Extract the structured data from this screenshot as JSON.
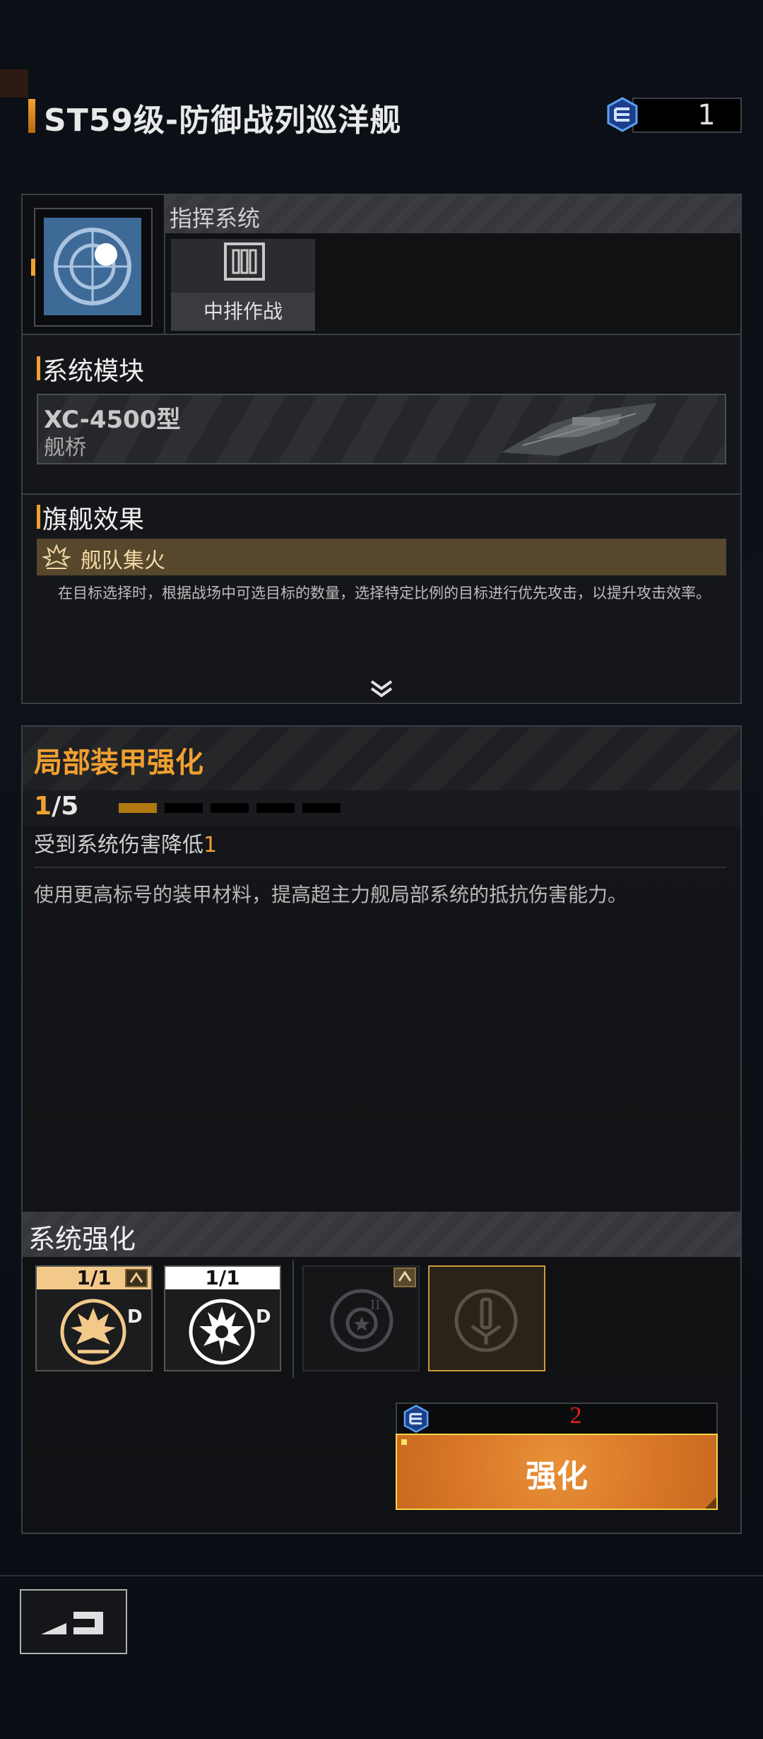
{
  "header": {
    "title": "ST59级-防御战列巡洋舰",
    "currency_value": "1"
  },
  "command": {
    "section_label": "指挥系统",
    "tactic_label": "中排作战"
  },
  "module": {
    "section_title": "系统模块",
    "name": "XC-4500型",
    "sub": "舰桥"
  },
  "flagship": {
    "section_title": "旗舰效果",
    "effect_name": "舰队集火",
    "effect_desc": "在目标选择时，根据战场中可选目标的数量，选择特定比例的目标进行优先攻击，以提升攻击效率。"
  },
  "armor": {
    "title": "局部装甲强化",
    "level_current": "1",
    "level_sep_max": "/5",
    "level_current_value": 1,
    "level_max_value": 5,
    "effect_prefix": "受到系统伤害降低",
    "effect_value": "1",
    "description": "使用更高标号的装甲材料，提高超主力舰局部系统的抵抗伤害能力。"
  },
  "enhance": {
    "section_title": "系统强化",
    "cards": [
      {
        "count": "1/1",
        "grade": "D",
        "header_color": "#f3c98a"
      },
      {
        "count": "1/1",
        "grade": "D",
        "header_color": "#ffffff"
      }
    ],
    "cost": "2",
    "button_label": "强化"
  },
  "colors": {
    "accent": "#f0a030",
    "button": "#d87626",
    "cost": "#ee1c1c"
  }
}
